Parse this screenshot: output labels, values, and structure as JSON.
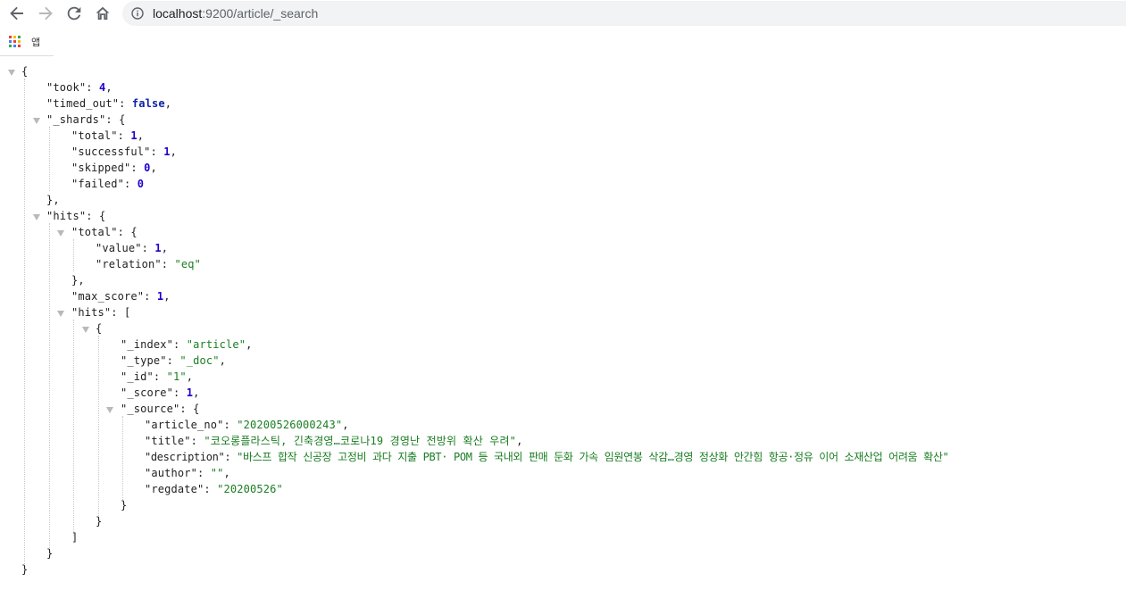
{
  "browser": {
    "url_host": "localhost",
    "url_rest": ":9200/article/_search",
    "bookmark_apps_label": "앱"
  },
  "json": {
    "took": "4",
    "timed_out": "false",
    "shards_total": "1",
    "shards_successful": "1",
    "shards_skipped": "0",
    "shards_failed": "0",
    "hits_total_value": "1",
    "hits_total_relation": "\"eq\"",
    "max_score": "1",
    "hit_index": "\"article\"",
    "hit_type": "\"_doc\"",
    "hit_id": "\"1\"",
    "hit_score": "1",
    "source_article_no": "\"20200526000243\"",
    "source_title": "\"코오롱플라스틱, 긴축경영…코로나19 경영난 전방위 확산 우려\"",
    "source_description": "\"바스프 합작 신공장 고정비 과다 지출 PBT· POM 등 국내외 판매 둔화 가속 임원연봉 삭감…경영 정상화 안간힘 항공·정유 이어 소재산업 어려움 확산\"",
    "source_author": "\"\"",
    "source_regdate": "\"20200526\""
  },
  "keys": {
    "took": "\"took\"",
    "timed_out": "\"timed_out\"",
    "shards": "\"_shards\"",
    "total": "\"total\"",
    "successful": "\"successful\"",
    "skipped": "\"skipped\"",
    "failed": "\"failed\"",
    "hits": "\"hits\"",
    "value": "\"value\"",
    "relation": "\"relation\"",
    "max_score": "\"max_score\"",
    "index": "\"_index\"",
    "type": "\"_type\"",
    "id": "\"_id\"",
    "score": "\"_score\"",
    "source": "\"_source\"",
    "article_no": "\"article_no\"",
    "title": "\"title\"",
    "description": "\"description\"",
    "author": "\"author\"",
    "regdate": "\"regdate\""
  },
  "colors": {
    "string": "#1a7d22",
    "number": "#1c00cf",
    "keyword": "#0d22aa"
  },
  "icons": {
    "back": "arrow-left-icon",
    "forward": "arrow-right-icon",
    "reload": "reload-icon",
    "home": "home-icon",
    "site_info": "info-icon",
    "apps": "apps-grid-icon",
    "collapse": "collapse-triangle-icon"
  }
}
